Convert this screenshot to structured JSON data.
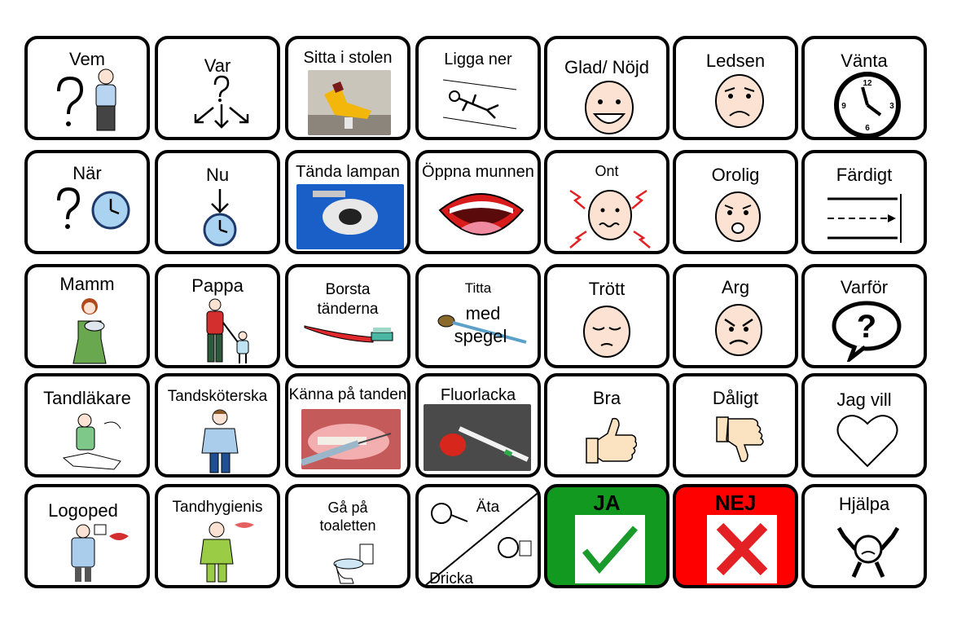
{
  "cards": [
    {
      "label": "Vem",
      "icon": "question-person-icon"
    },
    {
      "label": "Var",
      "icon": "question-arrows-icon"
    },
    {
      "label": "Sitta i stolen",
      "icon": "dental-chair-photo"
    },
    {
      "label": "Ligga ner",
      "icon": "lying-person-icon"
    },
    {
      "label": "Glad/ Nöjd",
      "icon": "happy-face-icon"
    },
    {
      "label": "Ledsen",
      "icon": "sad-face-icon"
    },
    {
      "label": "Vänta",
      "icon": "clock-icon"
    },
    {
      "label": "När",
      "icon": "question-clock-icon"
    },
    {
      "label": "Nu",
      "icon": "arrow-clock-icon"
    },
    {
      "label": "Tända lampan",
      "icon": "dental-lamp-photo"
    },
    {
      "label": "Öppna munnen",
      "icon": "open-mouth-icon"
    },
    {
      "label": "Ont",
      "icon": "pain-face-icon"
    },
    {
      "label": "Orolig",
      "icon": "worried-face-icon"
    },
    {
      "label": "Färdigt",
      "icon": "finish-line-icon"
    },
    {
      "label": "Mamm",
      "icon": "mother-baby-icon"
    },
    {
      "label": "Pappa",
      "icon": "father-child-icon"
    },
    {
      "label": "Borsta tänderna",
      "icon": "toothbrush-icon"
    },
    {
      "label_lines": [
        "Titta",
        "med",
        "spegel"
      ],
      "icon": "dental-mirror-icon"
    },
    {
      "label": "Trött",
      "icon": "tired-face-icon"
    },
    {
      "label": "Arg",
      "icon": "angry-face-icon"
    },
    {
      "label": "Varför",
      "icon": "question-bubble-icon"
    },
    {
      "label": "Tandläkare",
      "icon": "dentist-icon"
    },
    {
      "label": "Tandsköterska",
      "icon": "dental-nurse-icon"
    },
    {
      "label": "Känna på tanden",
      "icon": "probe-tooth-photo"
    },
    {
      "label": "Fluorlacka",
      "icon": "fluoride-photo"
    },
    {
      "label": "Bra",
      "icon": "thumbs-up-icon"
    },
    {
      "label": "Dåligt",
      "icon": "thumbs-down-icon"
    },
    {
      "label": "Jag vill",
      "icon": "heart-icon"
    },
    {
      "label": "Logoped",
      "icon": "speech-therapist-icon"
    },
    {
      "label": "Tandhygienis",
      "icon": "hygienist-icon"
    },
    {
      "label": "Gå på toaletten",
      "icon": "toilet-icon"
    },
    {
      "label": "Äta",
      "label2": "Dricka",
      "icon": "eat-drink-icon"
    },
    {
      "label": "JA",
      "icon": "checkmark-icon",
      "color": "#119a1f"
    },
    {
      "label": "NEJ",
      "icon": "cross-icon",
      "color": "#ff0000"
    },
    {
      "label": "Hjälpa",
      "icon": "help-icon"
    }
  ],
  "colors": {
    "yes": "#119a1f",
    "no": "#ff0000",
    "cross": "#e32125",
    "check": "#1a9a2a",
    "skin": "#fbe2d2"
  }
}
